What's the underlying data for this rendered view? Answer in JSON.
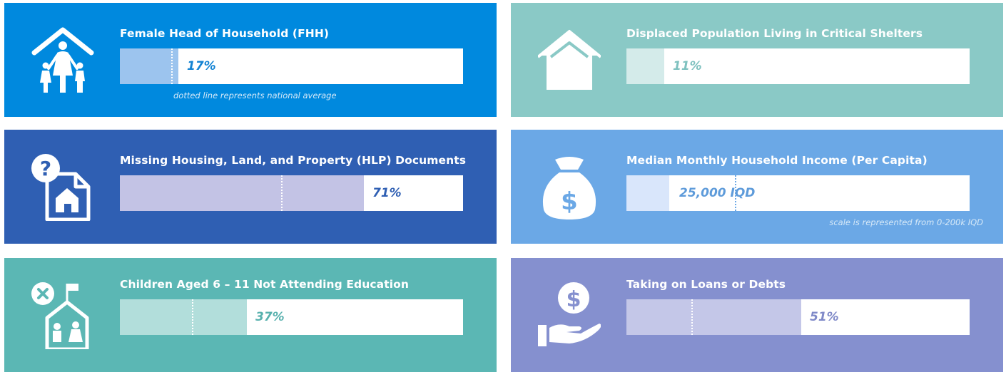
{
  "colors": {
    "fhh_bg": "#0089DE",
    "fhh_fill": "#9CC4EE",
    "fhh_val": "#1383D3",
    "shelter_bg": "#8AC9C6",
    "shelter_fill": "#D4EBEA",
    "shelter_val": "#7EC1BF",
    "hlp_bg": "#2F5FB3",
    "hlp_fill": "#C3C3E5",
    "hlp_val": "#2F5FB3",
    "income_bg": "#6BA8E6",
    "income_fill": "#D9E6FB",
    "income_val": "#5E9BDA",
    "edu_bg": "#5BB7B4",
    "edu_fill": "#B2DEDB",
    "edu_val": "#58B1AE",
    "loans_bg": "#8590CF",
    "loans_fill": "#C4C7E8",
    "loans_val": "#7F89C8"
  },
  "icons": {
    "fhh": "family-house-icon",
    "shelter": "house-icon",
    "hlp": "missing-document-icon",
    "income": "money-bag-icon",
    "edu": "school-no-attendance-icon",
    "loans": "hand-coin-icon"
  },
  "chart_data": [
    {
      "type": "bar",
      "title": "Female Head of Household (FHH)",
      "value": 17,
      "value_label": "17%",
      "national_average": 15,
      "note": "dotted line represents national average",
      "xlim": [
        0,
        100
      ]
    },
    {
      "type": "bar",
      "title": "Displaced Population Living in Critical Shelters",
      "value": 11,
      "value_label": "11%",
      "national_average": 11,
      "xlim": [
        0,
        100
      ]
    },
    {
      "type": "bar",
      "title": "Missing Housing, Land, and Property (HLP) Documents",
      "value": 71,
      "value_label": "71%",
      "national_average": 47,
      "xlim": [
        0,
        100
      ]
    },
    {
      "type": "bar",
      "title": "Median Monthly Household Income (Per Capita)",
      "value": 25000,
      "value_label": "25,000 IQD",
      "national_average": 63000,
      "note": "scale is represented from 0-200k IQD",
      "xlim": [
        0,
        200000
      ]
    },
    {
      "type": "bar",
      "title": "Children Aged 6 – 11 Not Attending Education",
      "value": 37,
      "value_label": "37%",
      "national_average": 21,
      "xlim": [
        0,
        100
      ]
    },
    {
      "type": "bar",
      "title": "Taking on Loans or Debts",
      "value": 51,
      "value_label": "51%",
      "national_average": 19,
      "xlim": [
        0,
        100
      ]
    }
  ]
}
